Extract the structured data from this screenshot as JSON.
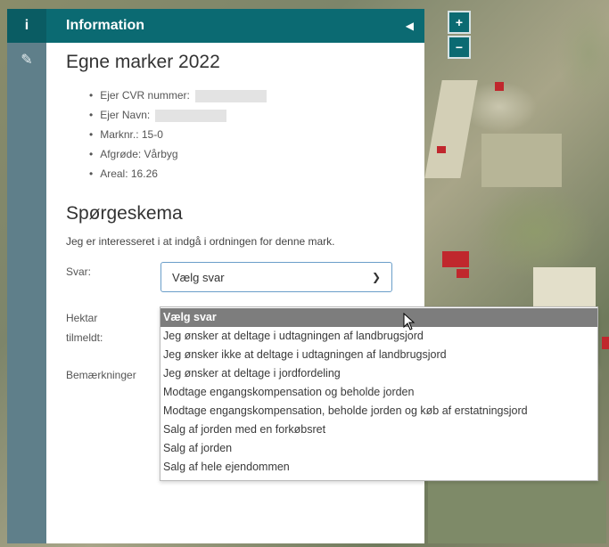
{
  "rail": {
    "info_glyph": "i",
    "edit_glyph": "✎"
  },
  "panel": {
    "title": "Information",
    "collapse_glyph": "◀"
  },
  "field": {
    "heading": "Egne marker 2022",
    "cvr_label": "Ejer CVR nummer:",
    "owner_label": "Ejer Navn:",
    "field_no": "Marknr.: 15-0",
    "crop": "Afgrøde: Vårbyg",
    "area": "Areal: 16.26"
  },
  "survey": {
    "heading": "Spørgeskema",
    "intro": "Jeg er interesseret i at indgå i ordningen for denne mark.",
    "answer_label": "Svar:",
    "answer_value": "Vælg svar",
    "hectare_label_1": "Hektar",
    "hectare_label_2": "tilmeldt:",
    "remarks_label": "Bemærkninger"
  },
  "dropdown_options": [
    "Vælg svar",
    "Jeg ønsker at deltage i udtagningen af landbrugsjord",
    "Jeg ønsker ikke at deltage i udtagningen af landbrugsjord",
    "Jeg ønsker at deltage i jordfordeling",
    "Modtage engangskompensation og beholde jorden",
    "Modtage engangskompensation, beholde jorden og køb af erstatningsjord",
    "Salg af jorden med en forkøbsret",
    "Salg af jorden",
    "Salg af hele ejendommen"
  ],
  "zoom": {
    "in": "+",
    "out": "−"
  },
  "colors": {
    "header": "#0b6a72",
    "rail": "#5f7f8a",
    "selected_option": "#7d7d7d"
  }
}
